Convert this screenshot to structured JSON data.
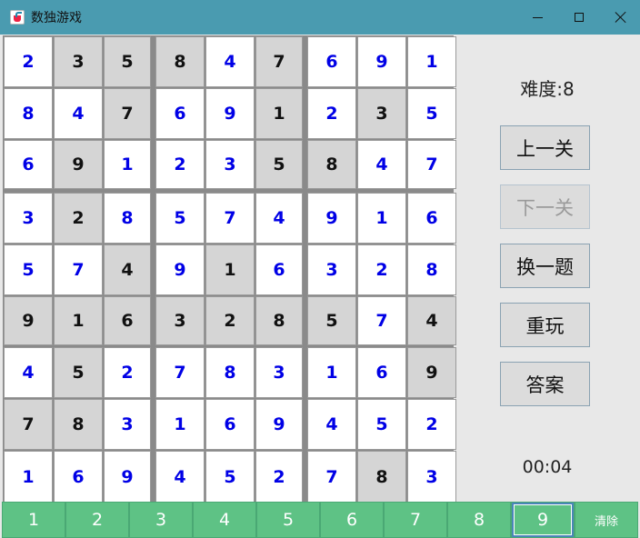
{
  "window": {
    "title": "数独游戏"
  },
  "board": {
    "given_color": "#d5d5d5",
    "user_color": "#0000e6",
    "rows": [
      [
        {
          "v": "2",
          "g": false
        },
        {
          "v": "3",
          "g": true
        },
        {
          "v": "5",
          "g": true
        },
        {
          "v": "8",
          "g": true
        },
        {
          "v": "4",
          "g": false
        },
        {
          "v": "7",
          "g": true
        },
        {
          "v": "6",
          "g": false
        },
        {
          "v": "9",
          "g": false
        },
        {
          "v": "1",
          "g": false
        }
      ],
      [
        {
          "v": "8",
          "g": false
        },
        {
          "v": "4",
          "g": false
        },
        {
          "v": "7",
          "g": true
        },
        {
          "v": "6",
          "g": false
        },
        {
          "v": "9",
          "g": false
        },
        {
          "v": "1",
          "g": true
        },
        {
          "v": "2",
          "g": false
        },
        {
          "v": "3",
          "g": true
        },
        {
          "v": "5",
          "g": false
        }
      ],
      [
        {
          "v": "6",
          "g": false
        },
        {
          "v": "9",
          "g": true
        },
        {
          "v": "1",
          "g": false
        },
        {
          "v": "2",
          "g": false
        },
        {
          "v": "3",
          "g": false
        },
        {
          "v": "5",
          "g": true
        },
        {
          "v": "8",
          "g": true
        },
        {
          "v": "4",
          "g": false
        },
        {
          "v": "7",
          "g": false
        }
      ],
      [
        {
          "v": "3",
          "g": false
        },
        {
          "v": "2",
          "g": true
        },
        {
          "v": "8",
          "g": false
        },
        {
          "v": "5",
          "g": false
        },
        {
          "v": "7",
          "g": false
        },
        {
          "v": "4",
          "g": false
        },
        {
          "v": "9",
          "g": false
        },
        {
          "v": "1",
          "g": false
        },
        {
          "v": "6",
          "g": false
        }
      ],
      [
        {
          "v": "5",
          "g": false
        },
        {
          "v": "7",
          "g": false
        },
        {
          "v": "4",
          "g": true
        },
        {
          "v": "9",
          "g": false
        },
        {
          "v": "1",
          "g": true
        },
        {
          "v": "6",
          "g": false
        },
        {
          "v": "3",
          "g": false
        },
        {
          "v": "2",
          "g": false
        },
        {
          "v": "8",
          "g": false
        }
      ],
      [
        {
          "v": "9",
          "g": true
        },
        {
          "v": "1",
          "g": true
        },
        {
          "v": "6",
          "g": true
        },
        {
          "v": "3",
          "g": true
        },
        {
          "v": "2",
          "g": true
        },
        {
          "v": "8",
          "g": true
        },
        {
          "v": "5",
          "g": true
        },
        {
          "v": "7",
          "g": false
        },
        {
          "v": "4",
          "g": true
        }
      ],
      [
        {
          "v": "4",
          "g": false
        },
        {
          "v": "5",
          "g": true
        },
        {
          "v": "2",
          "g": false
        },
        {
          "v": "7",
          "g": false
        },
        {
          "v": "8",
          "g": false
        },
        {
          "v": "3",
          "g": false
        },
        {
          "v": "1",
          "g": false
        },
        {
          "v": "6",
          "g": false
        },
        {
          "v": "9",
          "g": true
        }
      ],
      [
        {
          "v": "7",
          "g": true
        },
        {
          "v": "8",
          "g": true
        },
        {
          "v": "3",
          "g": false
        },
        {
          "v": "1",
          "g": false
        },
        {
          "v": "6",
          "g": false
        },
        {
          "v": "9",
          "g": false
        },
        {
          "v": "4",
          "g": false
        },
        {
          "v": "5",
          "g": false
        },
        {
          "v": "2",
          "g": false
        }
      ],
      [
        {
          "v": "1",
          "g": false
        },
        {
          "v": "6",
          "g": false
        },
        {
          "v": "9",
          "g": false
        },
        {
          "v": "4",
          "g": false
        },
        {
          "v": "5",
          "g": false
        },
        {
          "v": "2",
          "g": false
        },
        {
          "v": "7",
          "g": false
        },
        {
          "v": "8",
          "g": true
        },
        {
          "v": "3",
          "g": false
        }
      ]
    ]
  },
  "panel": {
    "difficulty": "难度:8",
    "buttons": [
      {
        "label": "上一关",
        "name": "prev-level-button",
        "enabled": true
      },
      {
        "label": "下一关",
        "name": "next-level-button",
        "enabled": false
      },
      {
        "label": "换一题",
        "name": "new-puzzle-button",
        "enabled": true
      },
      {
        "label": "重玩",
        "name": "replay-button",
        "enabled": true
      },
      {
        "label": "答案",
        "name": "answer-button",
        "enabled": true
      }
    ],
    "timer": "00:04"
  },
  "numpad": {
    "keys": [
      "1",
      "2",
      "3",
      "4",
      "5",
      "6",
      "7",
      "8",
      "9"
    ],
    "selected": "9",
    "clear_label": "清除",
    "accent": "#5ec285"
  }
}
